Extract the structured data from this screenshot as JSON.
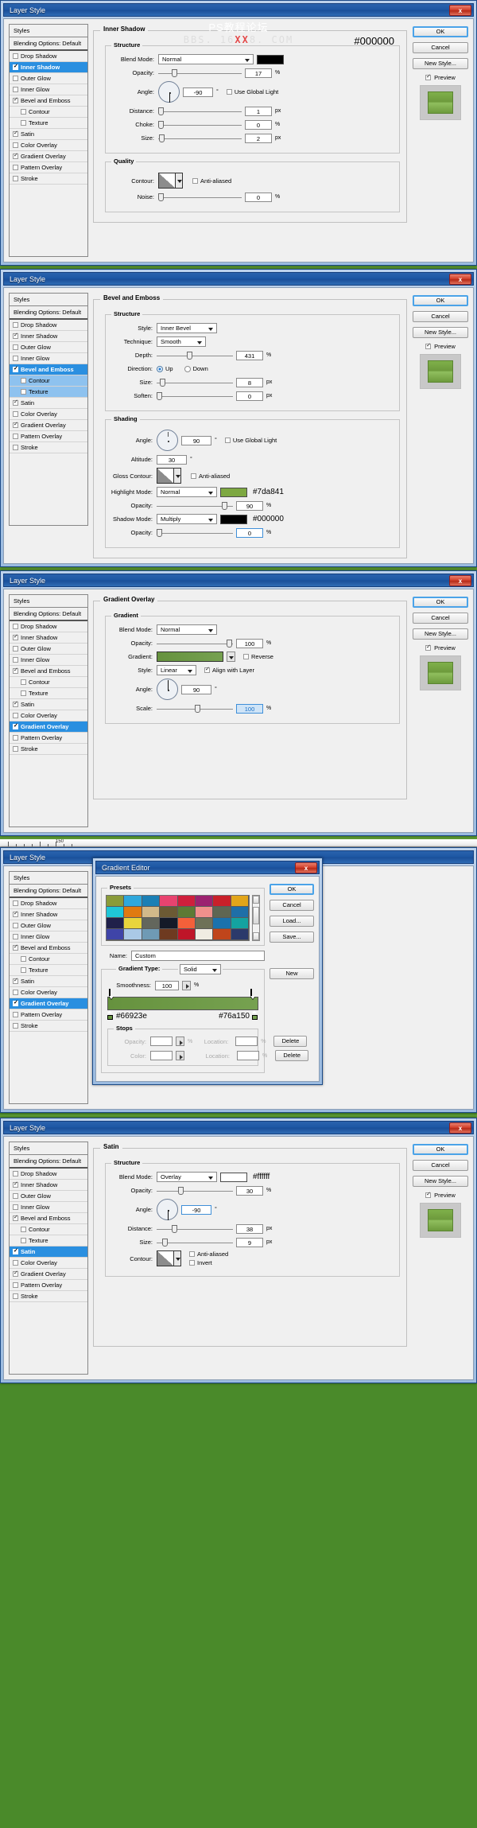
{
  "watermark": {
    "line1": "PS教程论坛",
    "line2_pre": "BBS. 16",
    "line2_red": "XX",
    "line2_post": "8. COM"
  },
  "window": {
    "title": "Layer Style",
    "close": "x",
    "gradient_editor_title": "Gradient Editor"
  },
  "buttons": {
    "ok": "OK",
    "cancel": "Cancel",
    "new_style": "New Style...",
    "preview": "Preview",
    "load": "Load...",
    "save": "Save...",
    "new": "New",
    "delete": "Delete"
  },
  "styles_list": {
    "header": "Styles",
    "blending": "Blending Options: Default",
    "items": [
      {
        "label": "Drop Shadow",
        "checked": false,
        "sub": false
      },
      {
        "label": "Inner Shadow",
        "checked": true,
        "sub": false
      },
      {
        "label": "Outer Glow",
        "checked": false,
        "sub": false
      },
      {
        "label": "Inner Glow",
        "checked": false,
        "sub": false
      },
      {
        "label": "Bevel and Emboss",
        "checked": true,
        "sub": false
      },
      {
        "label": "Contour",
        "checked": false,
        "sub": true
      },
      {
        "label": "Texture",
        "checked": false,
        "sub": true
      },
      {
        "label": "Satin",
        "checked": true,
        "sub": false
      },
      {
        "label": "Color Overlay",
        "checked": false,
        "sub": false
      },
      {
        "label": "Gradient Overlay",
        "checked": true,
        "sub": false
      },
      {
        "label": "Pattern Overlay",
        "checked": false,
        "sub": false
      },
      {
        "label": "Stroke",
        "checked": false,
        "sub": false
      }
    ]
  },
  "panel1": {
    "section_title": "Inner Shadow",
    "structure_label": "Structure",
    "quality_label": "Quality",
    "hex_note": "#000000",
    "blend_mode_label": "Blend Mode:",
    "blend_mode": "Normal",
    "color_hex": "#000000",
    "opacity_label": "Opacity:",
    "opacity": "17",
    "angle_label": "Angle:",
    "angle": "-90",
    "use_global_light": "Use Global Light",
    "distance_label": "Distance:",
    "distance": "1",
    "choke_label": "Choke:",
    "choke": "0",
    "size_label": "Size:",
    "size": "2",
    "contour_label": "Contour:",
    "anti_aliased": "Anti-aliased",
    "noise_label": "Noise:",
    "noise": "0",
    "unit_pct": "%",
    "unit_px": "px",
    "unit_deg": "°"
  },
  "panel2": {
    "section_title": "Bevel and Emboss",
    "structure_label": "Structure",
    "shading_label": "Shading",
    "style_label": "Style:",
    "style": "Inner Bevel",
    "technique_label": "Technique:",
    "technique": "Smooth",
    "depth_label": "Depth:",
    "depth": "431",
    "direction_label": "Direction:",
    "direction_up": "Up",
    "direction_down": "Down",
    "size_label": "Size:",
    "size": "8",
    "soften_label": "Soften:",
    "soften": "0",
    "angle_label": "Angle:",
    "angle": "90",
    "use_global_light": "Use Global Light",
    "altitude_label": "Altitude:",
    "altitude": "30",
    "gloss_contour_label": "Gloss Contour:",
    "anti_aliased": "Anti-aliased",
    "highlight_mode_label": "Highlight Mode:",
    "highlight_mode": "Normal",
    "highlight_color": "#7da841",
    "highlight_hex_note": "#7da841",
    "highlight_opacity_label": "Opacity:",
    "highlight_opacity": "90",
    "shadow_mode_label": "Shadow Mode:",
    "shadow_mode": "Multiply",
    "shadow_color": "#000000",
    "shadow_hex_note": "#000000",
    "shadow_opacity_label": "Opacity:",
    "shadow_opacity": "0",
    "unit_pct": "%",
    "unit_px": "px",
    "unit_deg": "°"
  },
  "panel3": {
    "section_title": "Gradient Overlay",
    "gradient_label": "Gradient",
    "blend_mode_label": "Blend Mode:",
    "blend_mode": "Normal",
    "opacity_label": "Opacity:",
    "opacity": "100",
    "gradient_swatch_label": "Gradient:",
    "reverse": "Reverse",
    "style_label": "Style:",
    "style": "Linear",
    "align_with_layer": "Align with Layer",
    "angle_label": "Angle:",
    "angle": "90",
    "scale_label": "Scale:",
    "scale": "100",
    "unit_pct": "%",
    "unit_deg": "°",
    "grad_from": "#66923e",
    "grad_to": "#76a150"
  },
  "panel4": {
    "title": "Gradient Editor",
    "presets_label": "Presets",
    "name_label": "Name:",
    "name_value": "Custom",
    "gradient_type_label": "Gradient Type:",
    "gradient_type": "Solid",
    "smoothness_label": "Smoothness:",
    "smoothness": "100",
    "stops_label": "Stops",
    "opacity_label": "Opacity:",
    "location_label": "Location:",
    "color_label": "Color:",
    "unit_pct": "%",
    "stop_left_hex": "#66923e",
    "stop_right_hex": "#76a150",
    "ruler_label": "150",
    "preset_colors": [
      "#8a9b3a",
      "#2fa8dc",
      "#1a7fb5",
      "#e8436f",
      "#cf1f3c",
      "#9c2270",
      "#c9202a",
      "#e2a51a",
      "#1fc6d8",
      "#e07a10",
      "#d2b98a",
      "#6b5a34",
      "#5d7a35",
      "#f0908c",
      "#5f6653",
      "#1f6fa8",
      "#20204a",
      "#e8d43c",
      "#63665c",
      "#141a28",
      "#f4603a",
      "#6e7157",
      "#1a72ad",
      "#14a2a0",
      "#3f44a8",
      "#aac9e6",
      "#6f9ab5",
      "#6e3a20",
      "#bf1528",
      "#f0ece2",
      "#c0451b",
      "#2b3a6b"
    ]
  },
  "panel5": {
    "section_title": "Satin",
    "structure_label": "Structure",
    "blend_mode_label": "Blend Mode:",
    "blend_mode": "Overlay",
    "color_hex": "#ffffff",
    "hex_note": "#ffffff",
    "opacity_label": "Opacity:",
    "opacity": "30",
    "angle_label": "Angle:",
    "angle": "-90",
    "distance_label": "Distance:",
    "distance": "38",
    "size_label": "Size:",
    "size": "9",
    "contour_label": "Contour:",
    "anti_aliased": "Anti-aliased",
    "invert": "Invert",
    "unit_pct": "%",
    "unit_px": "px",
    "unit_deg": "°"
  }
}
